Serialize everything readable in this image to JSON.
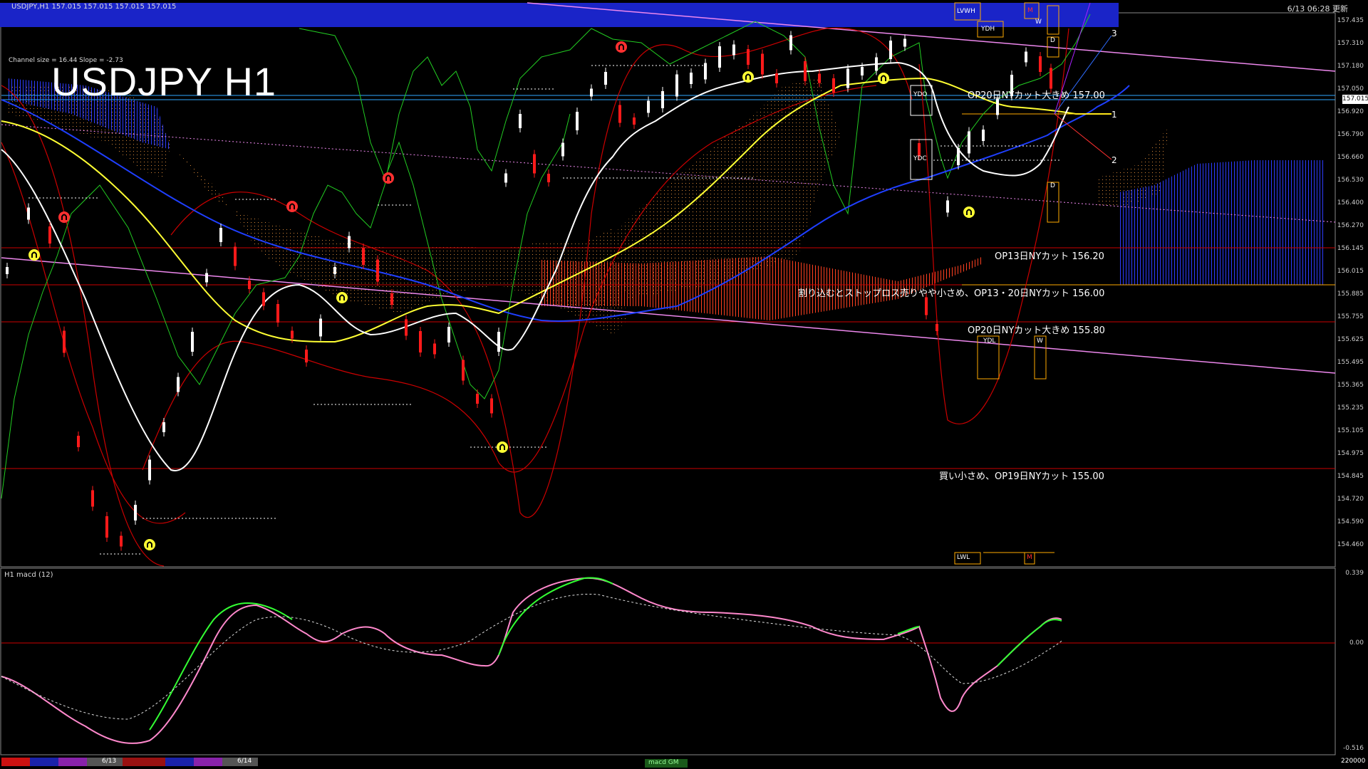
{
  "header": {
    "symbol_line": "USDJPY,H1  157.015 157.015 157.015 157.015",
    "clock": "6/13 06:28 更新"
  },
  "channel_info": "Channel size = 16.44 Slope = -2.73",
  "big_title": "USDJPY H1",
  "notes": {
    "n1": "OP20日NYカット大きめ 157.00",
    "n2": "OP13日NYカット 156.20",
    "n3": "割り込むとストップロス売りやや小さめ、OP13・20日NYカット 156.00",
    "n4": "OP20日NYカット大きめ 155.80",
    "n5": "買い小さめ、OP19日NYカット 155.00"
  },
  "box_labels": {
    "lwh": "LVWH",
    "ydh": "YDH",
    "m_top": "M",
    "w_top": "W",
    "d_top": "D",
    "ydo": "YDO",
    "ydc": "YDC",
    "d_mid": "D",
    "ydl": "YDL",
    "w_low": "W",
    "lwl": "LWL",
    "m_low": "M"
  },
  "fib_labels": {
    "f1": "1",
    "f2": "2",
    "f3": "3"
  },
  "price_axis": [
    "157.435",
    "157.310",
    "157.180",
    "157.050",
    "156.920",
    "156.790",
    "156.660",
    "156.530",
    "156.400",
    "156.270",
    "156.145",
    "156.015",
    "155.885",
    "155.755",
    "155.625",
    "155.495",
    "155.365",
    "155.235",
    "155.105",
    "154.975",
    "154.845",
    "154.720",
    "154.590",
    "154.460"
  ],
  "current_price": "157.015",
  "macd": {
    "label": "H1  macd (12)",
    "axis_top": "0.339",
    "axis_zero": "0.00",
    "axis_bottom": "-0.516"
  },
  "bottom_bar": {
    "date1": "6/13",
    "date2": "6/14",
    "tag": "macd GM",
    "right_value": "220000"
  },
  "colors": {
    "background": "#000000",
    "bull_candle": "#ffffff",
    "bear_candle": "#ff0000",
    "ma_white": "#ffffff",
    "ma_yellow": "#ffff33",
    "ma_blue": "#1f3fff",
    "bollinger": "#cc0000",
    "cloud_orange": "#ff8a1a",
    "channel_pink": "#ee88ee",
    "macd_green": "#33ff33",
    "macd_pink": "#ff88cc"
  }
}
